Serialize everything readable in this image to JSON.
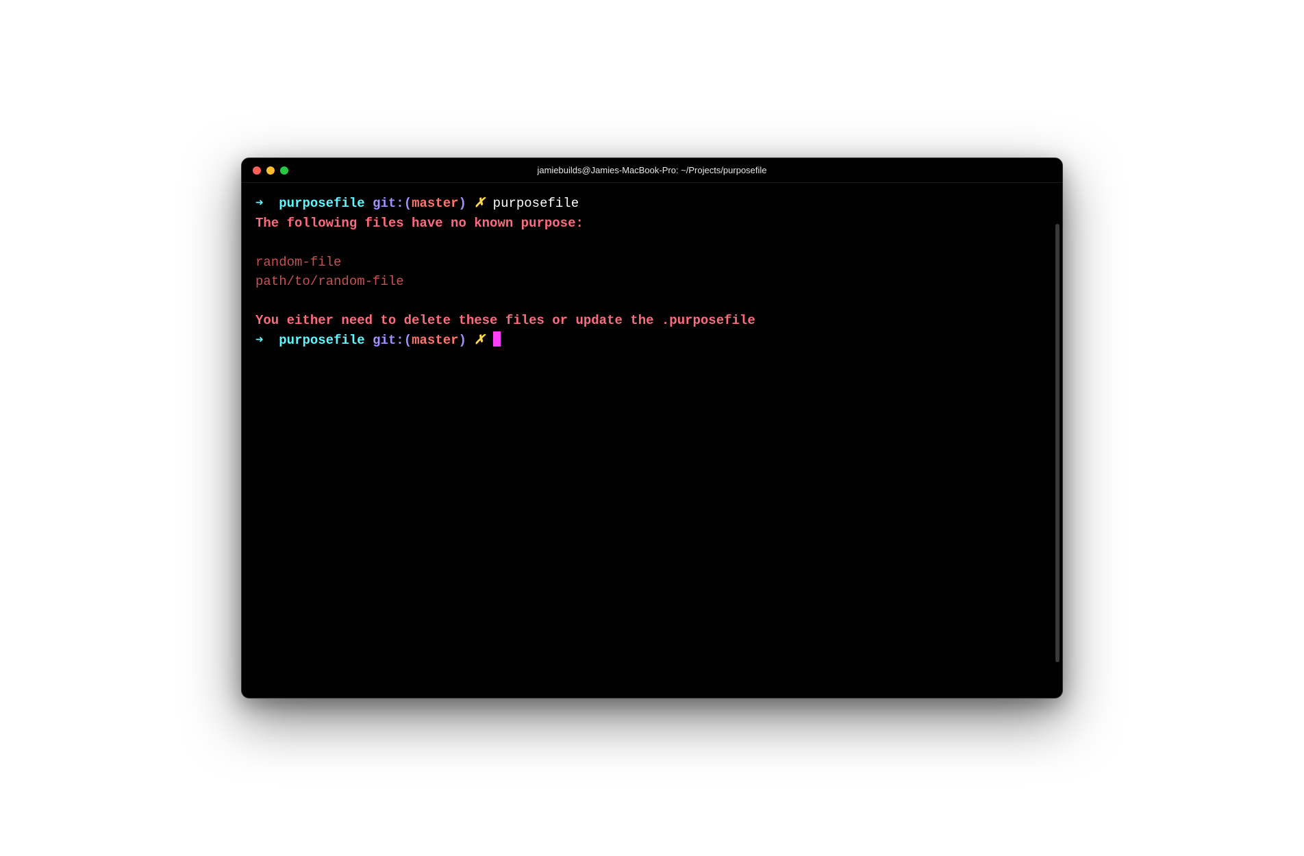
{
  "window": {
    "title": "jamiebuilds@Jamies-MacBook-Pro: ~/Projects/purposefile"
  },
  "prompt": {
    "arrow": "➜",
    "dir": "purposefile",
    "git_label": "git:(",
    "branch": "master",
    "git_close": ")",
    "dirty": "✗"
  },
  "lines": {
    "command": "purposefile",
    "output_header": "The following files have no known purpose:",
    "file1": "random-file",
    "file2": "path/to/random-file",
    "output_footer": "You either need to delete these files or update the .purposefile"
  }
}
